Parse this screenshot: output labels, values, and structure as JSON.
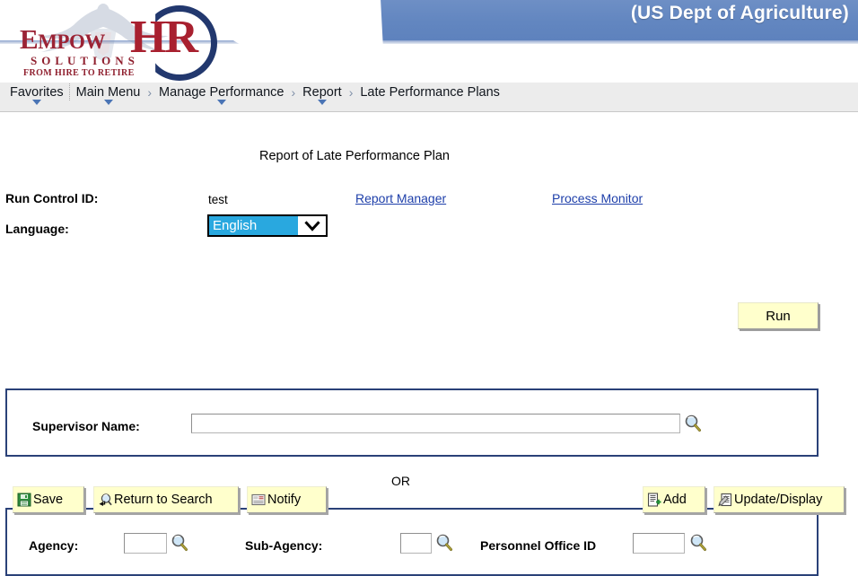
{
  "header": {
    "agency_title": "(US Dept of Agriculture)",
    "logo": {
      "word_empow": "EMPOW",
      "word_hr": "HR",
      "word_solutions": "SOLUTIONS",
      "tagline": "FROM HIRE TO RETIRE"
    }
  },
  "breadcrumb": {
    "items": [
      {
        "label": "Favorites",
        "has_caret": true,
        "separator_after": true
      },
      {
        "label": "Main Menu",
        "has_caret": true,
        "separator_after": false
      },
      {
        "label": "Manage Performance",
        "has_caret": true,
        "separator_after": false
      },
      {
        "label": "Report",
        "has_caret": true,
        "separator_after": false
      },
      {
        "label": "Late Performance Plans",
        "has_caret": false,
        "separator_after": false
      }
    ],
    "arrow": "›"
  },
  "main": {
    "page_title": "Report of Late Performance Plan",
    "run_control": {
      "label": "Run Control ID:",
      "value": "test"
    },
    "language": {
      "label": "Language:",
      "selected": "English",
      "options": [
        "English"
      ]
    },
    "links": {
      "report_manager": "Report Manager",
      "process_monitor": "Process Monitor"
    },
    "run_button": "Run",
    "supervisor_group": {
      "label": "Supervisor Name:",
      "value": "",
      "placeholder": "",
      "lookup_icon": "magnifier-icon"
    },
    "or_text": "OR",
    "agency_group": {
      "agency": {
        "label": "Agency:",
        "value": "",
        "lookup_icon": "magnifier-icon"
      },
      "sub_agency": {
        "label": "Sub-Agency:",
        "value": "",
        "lookup_icon": "magnifier-icon"
      },
      "personnel_office_id": {
        "label": "Personnel Office ID",
        "value": "",
        "lookup_icon": "magnifier-icon"
      }
    }
  },
  "toolbar": {
    "save": "Save",
    "return_to_search": "Return to Search",
    "notify": "Notify",
    "add": "Add",
    "update_display": "Update/Display"
  },
  "colors": {
    "header_blue": "#6286c0",
    "groupbox_border": "#2a4178",
    "button_yellow": "#ffffcc",
    "link_blue": "#1e3faa",
    "select_highlight": "#29a8df",
    "logo_red": "#9b2335",
    "logo_navy": "#22386e"
  }
}
